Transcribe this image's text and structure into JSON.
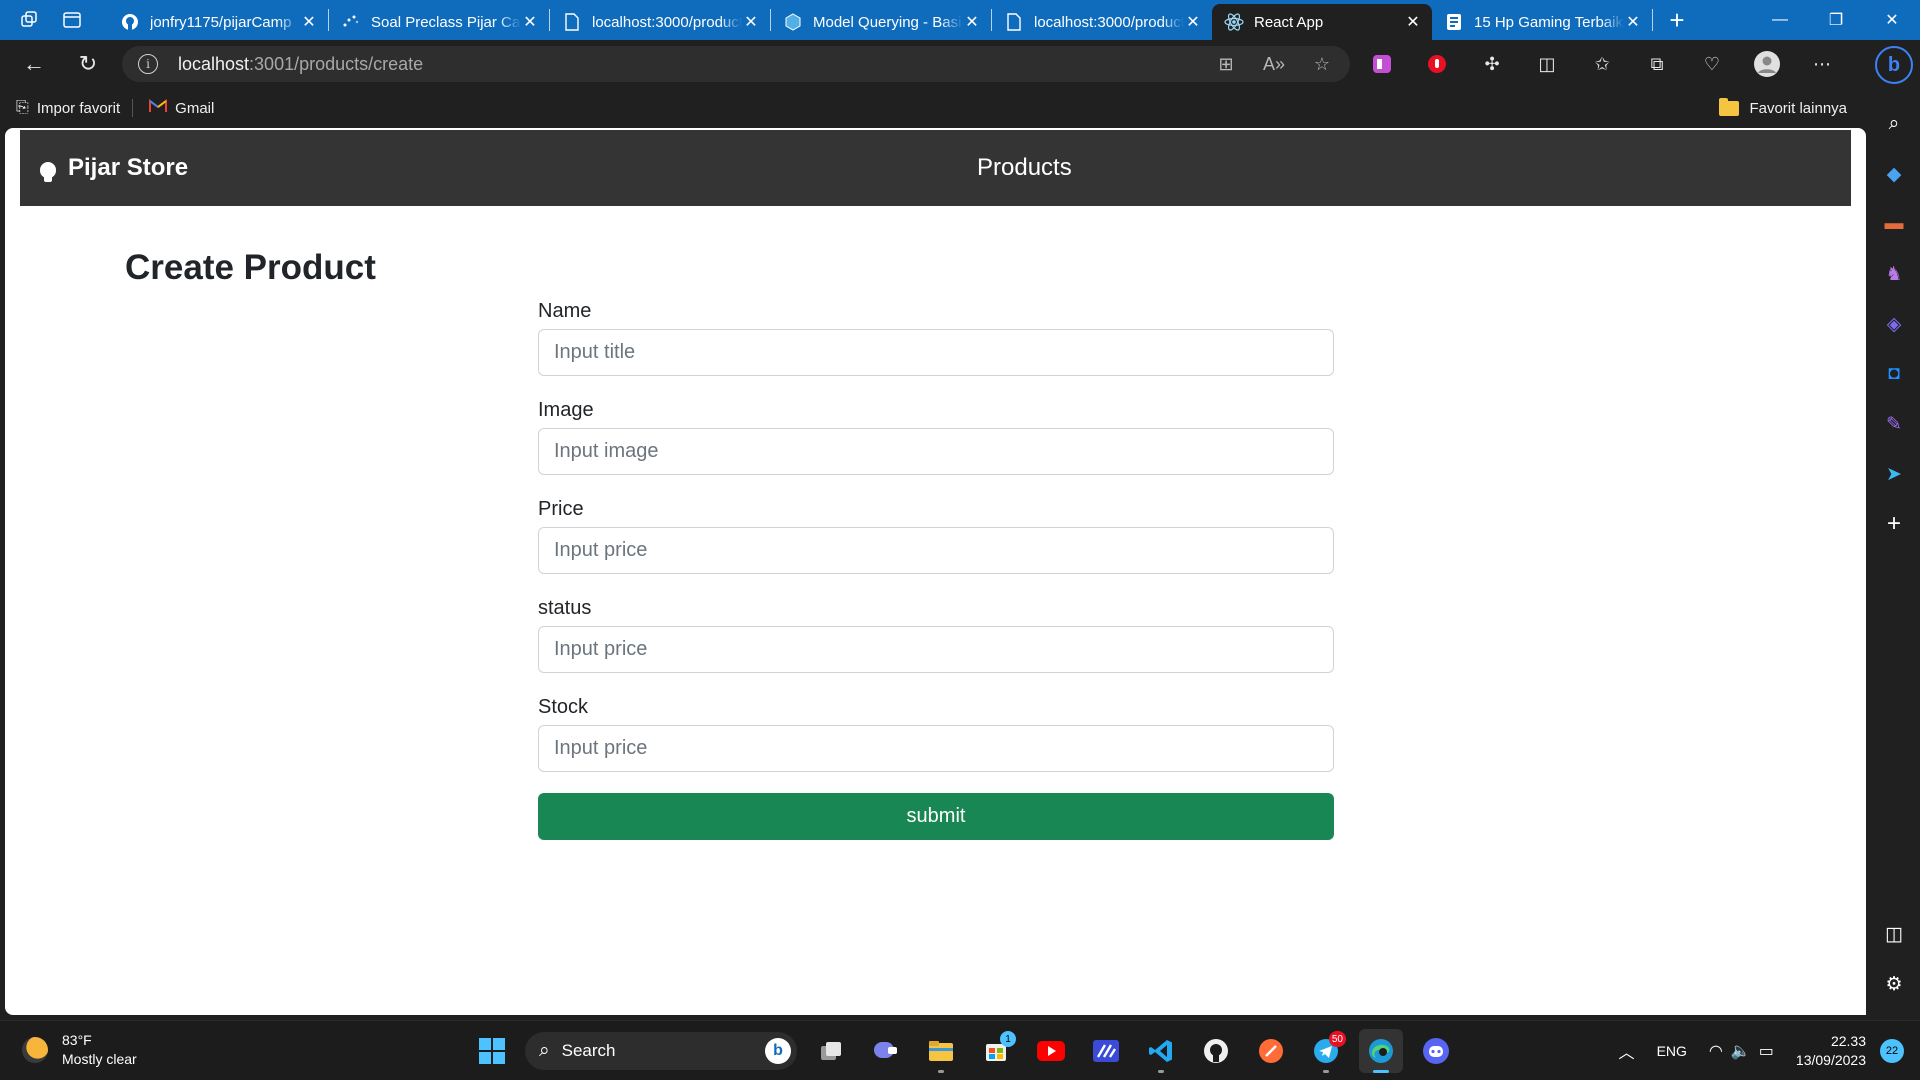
{
  "browser": {
    "tabs": [
      {
        "title": "jonfry1175/pijarCamp",
        "favicon": "github-icon",
        "active": false
      },
      {
        "title": "Soal Preclass Pijar Camp",
        "favicon": "loading-dots-icon",
        "active": false
      },
      {
        "title": "localhost:3000/products",
        "favicon": "page-icon",
        "active": false
      },
      {
        "title": "Model Querying - Basics",
        "favicon": "sequelize-icon",
        "active": false
      },
      {
        "title": "localhost:3000/products",
        "favicon": "page-icon",
        "active": false
      },
      {
        "title": "React App",
        "favicon": "react-icon",
        "active": true
      },
      {
        "title": "15 Hp Gaming Terbaik",
        "favicon": "doc-icon",
        "active": false
      }
    ],
    "url_host": "localhost",
    "url_path": ":3001/products/create",
    "favorites": {
      "import": "Impor favorit",
      "gmail": "Gmail",
      "other": "Favorit lainnya"
    }
  },
  "page": {
    "brand": "Pijar Store",
    "nav_link": "Products",
    "heading": "Create Product",
    "fields": [
      {
        "label": "Name",
        "placeholder": "Input title"
      },
      {
        "label": "Image",
        "placeholder": "Input image"
      },
      {
        "label": "Price",
        "placeholder": "Input price"
      },
      {
        "label": "status",
        "placeholder": "Input price"
      },
      {
        "label": "Stock",
        "placeholder": "Input price"
      }
    ],
    "submit_label": "submit",
    "colors": {
      "navbar": "#343434",
      "submit": "#198754"
    }
  },
  "taskbar": {
    "weather_temp": "83°F",
    "weather_desc": "Mostly clear",
    "search_label": "Search",
    "store_badge": "1",
    "telegram_badge": "50",
    "language": "ENG",
    "time": "22.33",
    "date": "13/09/2023",
    "notifications": "22"
  }
}
